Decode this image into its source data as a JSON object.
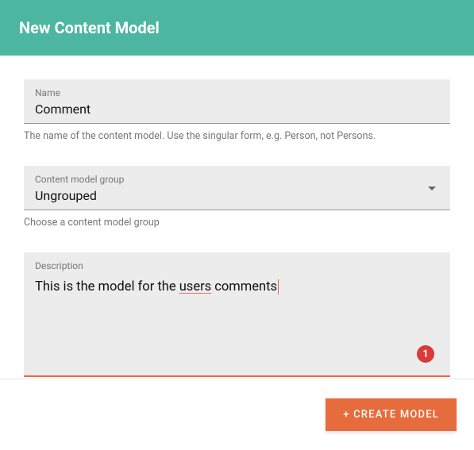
{
  "header": {
    "title": "New Content Model"
  },
  "fields": {
    "name": {
      "label": "Name",
      "value": "Comment",
      "helper": "The name of the content model. Use the singular form, e.g. Person, not Persons."
    },
    "group": {
      "label": "Content model group",
      "value": "Ungrouped",
      "helper": "Choose a content model group"
    },
    "description": {
      "label": "Description",
      "value_pre": "This is the model for the ",
      "value_spell": "users",
      "value_post": " comments",
      "badge": "1"
    }
  },
  "footer": {
    "create_label": "+ CREATE MODEL"
  }
}
